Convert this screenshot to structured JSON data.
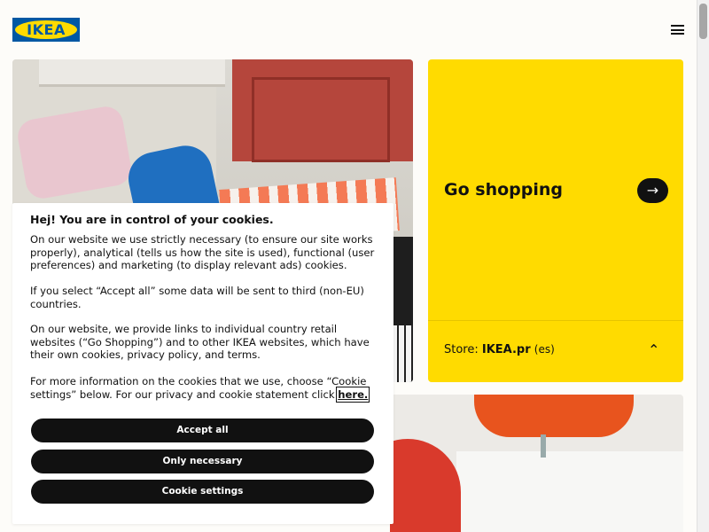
{
  "header": {
    "logo_text": "IKEA",
    "brand_colors": {
      "blue": "#0058a3",
      "yellow": "#ffdb00"
    },
    "menu_icon": "hamburger-menu-icon"
  },
  "shop_card": {
    "title": "Go shopping",
    "arrow_icon": "arrow-right-icon",
    "store_label": "Store:",
    "store_name": "IKEA.pr",
    "store_lang": "(es)",
    "chevron_icon": "chevron-up-icon",
    "background": "#ffdb00"
  },
  "cookie_dialog": {
    "title": "Hej! You are in control of your cookies.",
    "paragraph_1": "On our website we use strictly necessary (to ensure our site works properly), analytical (tells us how the site is used), functional (user preferences) and marketing (to display relevant ads) cookies.",
    "paragraph_2": "If you select “Accept all” some data will be sent to third (non-EU) countries.",
    "paragraph_3": "On our website, we provide links to individual country retail websites (“Go Shopping”) and to other IKEA websites, which have their own cookies, privacy policy, and terms.",
    "paragraph_4": "For more information on the cookies that we use, choose “Cookie settings” below. For our privacy and cookie statement click",
    "link_text": "here.",
    "buttons": {
      "accept_all": "Accept all",
      "only_necessary": "Only necessary",
      "cookie_settings": "Cookie settings"
    }
  }
}
